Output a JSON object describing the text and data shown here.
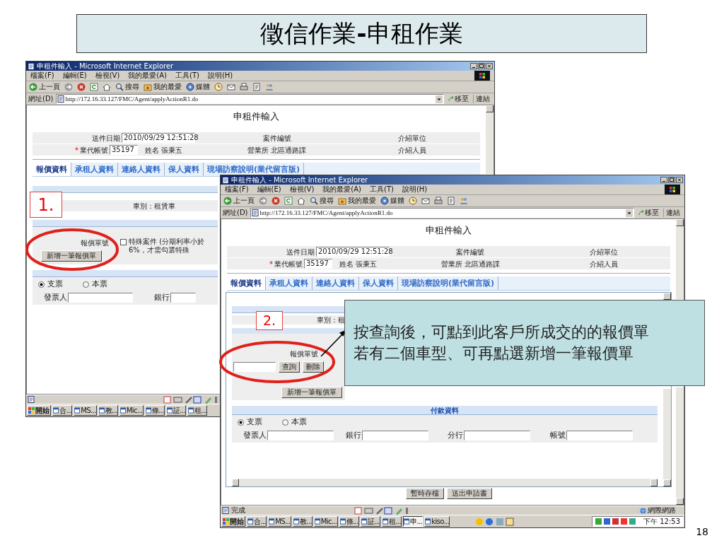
{
  "slide": {
    "title": "徵信作業**-**申租作業",
    "page_number": "18"
  },
  "windows": [
    {
      "title": "申租件輸入 - Microsoft Internet Explorer",
      "menu": [
        "檔案(F)",
        "編輯(E)",
        "檢視(V)",
        "我的最愛(A)",
        "工具(T)",
        "說明(H)"
      ],
      "toolbar": [
        {
          "kind": "back",
          "label": "上一頁"
        },
        {
          "kind": "forward"
        },
        {
          "kind": "stop"
        },
        {
          "kind": "refresh"
        },
        {
          "kind": "home"
        },
        {
          "kind": "search",
          "label": "搜尋"
        },
        {
          "kind": "favorites",
          "label": "我的最愛"
        },
        {
          "kind": "media",
          "label": "媒體"
        },
        {
          "kind": "history"
        },
        {
          "kind": "mail"
        },
        {
          "kind": "print"
        },
        {
          "kind": "edit"
        },
        {
          "kind": "discuss"
        }
      ],
      "address": {
        "label": "網址(D)",
        "url": "http://172.16.33.127/FMC/Agent/applyActionR1.do",
        "go": "移至",
        "links": "連結"
      },
      "page": {
        "heading": "申租件輸入",
        "form": {
          "date_label": "送件日期",
          "date_value": "2010/09/29 12:51:28",
          "required_mark": "*",
          "agent_label": "業代帳號",
          "agent_value": "35197",
          "name": "姓名 張秉五",
          "case_label": "案件編號",
          "office": "營業所 北區通路課",
          "referrer_unit": "介紹單位",
          "referrer": "介紹人員"
        },
        "tabs": [
          {
            "label": "報價資料",
            "selected": true
          },
          {
            "label": "承租人資料",
            "selected": false
          },
          {
            "label": "連絡人資料",
            "selected": false
          },
          {
            "label": "保人資料",
            "selected": false
          },
          {
            "label": "現場訪察說明(業代留言版)",
            "selected": false
          }
        ],
        "car_type": "車別：租賃車",
        "quote_label": "報價單號",
        "special_case": {
          "checked": false,
          "label": "特殊案件 (分期利率小於6%，才需勾選特殊"
        },
        "add_button": "新增一筆報價單",
        "payment": {
          "radios": [
            {
              "label": "支票",
              "selected": true
            },
            {
              "label": "本票",
              "selected": false
            }
          ],
          "fields": [
            "發票人",
            "銀行"
          ]
        }
      },
      "taskbar": {
        "start": "開始",
        "items": [
          {
            "label": "合...",
            "selected": false
          },
          {
            "label": "MS...",
            "selected": false
          },
          {
            "label": "教...",
            "selected": false
          },
          {
            "label": "Mic...",
            "selected": false
          },
          {
            "label": "條...",
            "selected": false
          },
          {
            "label": "証...",
            "selected": false
          },
          {
            "label": "租...",
            "selected": false
          }
        ]
      }
    },
    {
      "title": "申租件輸入 - Microsoft Internet Explorer",
      "menu": [
        "檔案(F)",
        "編輯(E)",
        "檢視(V)",
        "我的最愛(A)",
        "工具(T)",
        "說明(H)"
      ],
      "toolbar": [
        {
          "kind": "back",
          "label": "上一頁"
        },
        {
          "kind": "forward"
        },
        {
          "kind": "stop"
        },
        {
          "kind": "refresh"
        },
        {
          "kind": "home"
        },
        {
          "kind": "search",
          "label": "搜尋"
        },
        {
          "kind": "favorites",
          "label": "我的最愛"
        },
        {
          "kind": "media",
          "label": "媒體"
        },
        {
          "kind": "history"
        },
        {
          "kind": "mail"
        },
        {
          "kind": "print"
        },
        {
          "kind": "edit"
        },
        {
          "kind": "discuss"
        }
      ],
      "address": {
        "label": "網址(D)",
        "url": "http://172.16.33.127/FMC/Agent/applyActionR1.do",
        "go": "移至",
        "links": "連結"
      },
      "page": {
        "heading": "申租件輸入",
        "form": {
          "date_label": "送件日期",
          "date_value": "2010/09/29 12:51:28",
          "required_mark": "*",
          "agent_label": "業代帳號",
          "agent_value": "35197",
          "name": "姓名 張秉五",
          "case_label": "案件編號",
          "office": "營業所 北區通路課",
          "referrer_unit": "介紹單位",
          "referrer": "介紹人員"
        },
        "tabs": [
          {
            "label": "報價資料",
            "selected": true
          },
          {
            "label": "承租人資料",
            "selected": false
          },
          {
            "label": "連絡人資料",
            "selected": false
          },
          {
            "label": "保人資料",
            "selected": false
          },
          {
            "label": "現場訪察說明(業代留言版)",
            "selected": false
          }
        ],
        "car_type": "車別：租",
        "quote_label": "報價單號",
        "search_button": "查詢",
        "delete_button": "刪除",
        "add_button": "新增一筆報價單",
        "payment": {
          "header": "付款資料",
          "radios": [
            {
              "label": "支票",
              "selected": true
            },
            {
              "label": "本票",
              "selected": false
            }
          ],
          "fields": [
            "發票人",
            "銀行",
            "分行",
            "帳號"
          ]
        },
        "actions": [
          "暫時存檔",
          "送出申請書"
        ]
      },
      "status": {
        "text": "完成",
        "zone": "網際網路"
      },
      "taskbar": {
        "start": "開始",
        "items": [
          {
            "label": "合...",
            "selected": false
          },
          {
            "label": "MS...",
            "selected": false
          },
          {
            "label": "教...",
            "selected": false
          },
          {
            "label": "Mic...",
            "selected": false
          },
          {
            "label": "條...",
            "selected": false
          },
          {
            "label": "証...",
            "selected": false
          },
          {
            "label": "租...",
            "selected": false
          },
          {
            "label": "申...",
            "selected": true
          },
          {
            "label": "kiso...",
            "selected": false
          }
        ],
        "clock": "下午 12:53"
      }
    }
  ],
  "step_labels": [
    "1.",
    "2."
  ],
  "callout": {
    "lines": [
      "按查詢後，可點到此客戶所成交的的報價單",
      "若有二個車型、可再點選新增一筆報價單"
    ]
  }
}
